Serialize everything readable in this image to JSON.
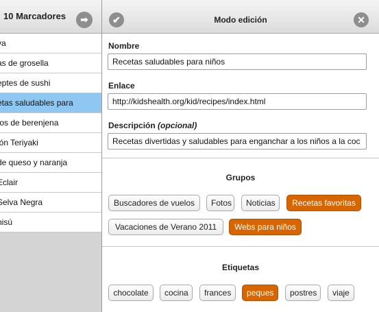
{
  "bookmarks_panel": {
    "title": "10 Marcadores",
    "arrow_icon": "forward-arrow-icon",
    "items": [
      "va",
      "as de grosella",
      "eptes de sushi",
      "etas saludables para",
      "tos de berenjena",
      "ión Teriyaki",
      "de queso y naranja",
      "Eclair",
      "Selva Negra",
      "nisú"
    ],
    "selected_index": 3
  },
  "edit_panel": {
    "title": "Modo edición",
    "confirm_icon": "checkmark-icon",
    "close_icon": "close-icon",
    "name_label": "Nombre",
    "name_value": "Recetas saludables para niños",
    "link_label": "Enlace",
    "link_value": "http://kidshealth.org/kid/recipes/index.html",
    "description_label": "Descripción",
    "description_optional": "(opcional)",
    "description_value": "Recetas divertidas y saludables para enganchar a los niños a la coc",
    "groups_title": "Grupos",
    "groups": [
      {
        "label": "Buscadores de vuelos",
        "selected": false
      },
      {
        "label": "Fotos",
        "selected": false
      },
      {
        "label": "Noticias",
        "selected": false
      },
      {
        "label": "Recetas favoritas",
        "selected": true
      },
      {
        "label": "Vacaciones de Verano 2011",
        "selected": false
      },
      {
        "label": "Webs para niños",
        "selected": true
      }
    ],
    "tags_title": "Etiquetas",
    "tags": [
      {
        "label": "chocolate",
        "selected": false
      },
      {
        "label": "cocina",
        "selected": false
      },
      {
        "label": "frances",
        "selected": false
      },
      {
        "label": "peques",
        "selected": true
      },
      {
        "label": "postres",
        "selected": false
      },
      {
        "label": "viaje",
        "selected": false
      }
    ]
  },
  "colors": {
    "selected_row": "#8ec7f2",
    "selected_tag": "#d86600"
  }
}
